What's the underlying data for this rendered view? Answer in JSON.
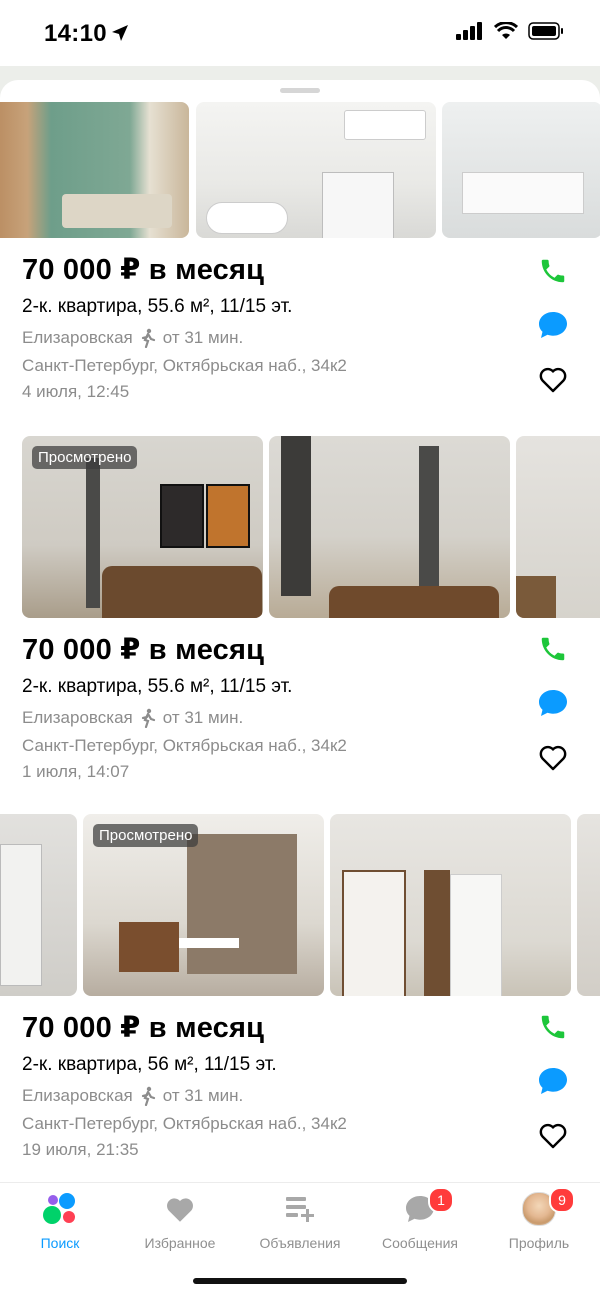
{
  "status": {
    "time": "14:10"
  },
  "listings": [
    {
      "price": "70 000 ₽ в месяц",
      "description": "2-к. квартира, 55.6 м², 11/15 эт.",
      "metro": "Елизаровская",
      "walk_time": "от 31 мин.",
      "address": "Санкт-Петербург, Октябрьская наб., 34к2",
      "date": "4 июля, 12:45",
      "badge": ""
    },
    {
      "price": "70 000 ₽ в месяц",
      "description": "2-к. квартира, 55.6 м², 11/15 эт.",
      "metro": "Елизаровская",
      "walk_time": "от 31 мин.",
      "address": "Санкт-Петербург, Октябрьская наб., 34к2",
      "date": "1 июля, 14:07",
      "badge": "Просмотрено"
    },
    {
      "price": "70 000 ₽ в месяц",
      "description": "2-к. квартира, 56 м², 11/15 эт.",
      "metro": "Елизаровская",
      "walk_time": "от 31 мин.",
      "address": "Санкт-Петербург, Октябрьская наб., 34к2",
      "date": "19 июля, 21:35",
      "badge": "Просмотрено"
    }
  ],
  "tabs": [
    {
      "label": "Поиск",
      "icon": "search-logo-icon",
      "active": true
    },
    {
      "label": "Избранное",
      "icon": "heart-icon"
    },
    {
      "label": "Объявления",
      "icon": "add-listing-icon"
    },
    {
      "label": "Сообщения",
      "icon": "chat-icon",
      "badge": "1"
    },
    {
      "label": "Профиль",
      "icon": "avatar",
      "badge": "9"
    }
  ],
  "colors": {
    "call": "#1dc63a",
    "chat": "#0b9bff",
    "active_tab": "#0b9bff",
    "badge": "#ff3b3b"
  }
}
